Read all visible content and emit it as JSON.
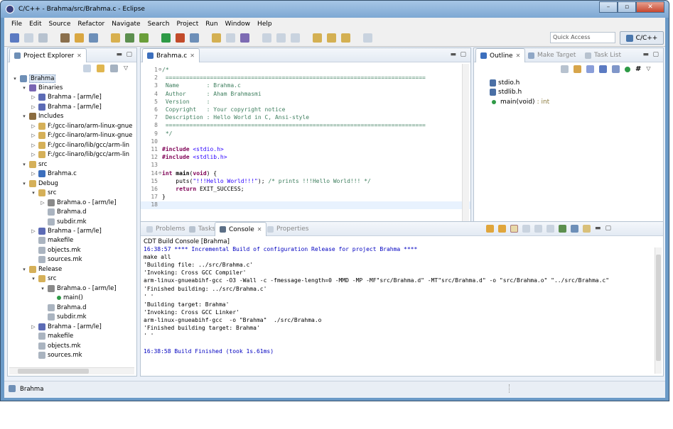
{
  "window": {
    "title": "C/C++ - Brahma/src/Brahma.c - Eclipse",
    "minimize": "–",
    "maximize": "▫",
    "close": "✕"
  },
  "menu": [
    "File",
    "Edit",
    "Source",
    "Refactor",
    "Navigate",
    "Search",
    "Project",
    "Run",
    "Window",
    "Help"
  ],
  "toolbar": {
    "quick_access_placeholder": "Quick Access",
    "perspective": "C/C++"
  },
  "colors": {
    "accent": "#4a77ad",
    "comment": "#3f7f5f",
    "keyword": "#7f0055",
    "string": "#2a00ff",
    "console_blue": "#0000c0"
  },
  "project_explorer": {
    "tab": "Project Explorer",
    "items": [
      {
        "label": "Brahma",
        "depth": 0,
        "arrow": "▾",
        "icon": "project-icon",
        "color": "#6e8fb6"
      },
      {
        "label": "Binaries",
        "depth": 1,
        "arrow": "▾",
        "icon": "binaries-icon",
        "color": "#7a66b3"
      },
      {
        "label": "Brahma - [arm/le]",
        "depth": 2,
        "arrow": "▷",
        "icon": "binary-file-icon",
        "color": "#5c6bb5"
      },
      {
        "label": "Brahma - [arm/le]",
        "depth": 2,
        "arrow": "▷",
        "icon": "binary-file-icon",
        "color": "#5c6bb5"
      },
      {
        "label": "Includes",
        "depth": 1,
        "arrow": "▾",
        "icon": "includes-icon",
        "color": "#8b6c3f"
      },
      {
        "label": "F:/gcc-linaro/arm-linux-gnue",
        "depth": 2,
        "arrow": "▷",
        "icon": "folder-icon",
        "color": "#d5b059"
      },
      {
        "label": "F:/gcc-linaro/arm-linux-gnue",
        "depth": 2,
        "arrow": "▷",
        "icon": "folder-icon",
        "color": "#d5b059"
      },
      {
        "label": "F:/gcc-linaro/lib/gcc/arm-lin",
        "depth": 2,
        "arrow": "▷",
        "icon": "folder-icon",
        "color": "#d5b059"
      },
      {
        "label": "F:/gcc-linaro/lib/gcc/arm-lin",
        "depth": 2,
        "arrow": "▷",
        "icon": "folder-icon",
        "color": "#d5b059"
      },
      {
        "label": "src",
        "depth": 1,
        "arrow": "▾",
        "icon": "source-folder-icon",
        "color": "#d5b059"
      },
      {
        "label": "Brahma.c",
        "depth": 2,
        "arrow": "▷",
        "icon": "c-file-icon",
        "color": "#3c6fbd"
      },
      {
        "label": "Debug",
        "depth": 1,
        "arrow": "▾",
        "icon": "folder-icon",
        "color": "#d5b059"
      },
      {
        "label": "src",
        "depth": 2,
        "arrow": "▾",
        "icon": "folder-icon",
        "color": "#d5b059"
      },
      {
        "label": "Brahma.o - [arm/le]",
        "depth": 3,
        "arrow": "▷",
        "icon": "object-file-icon",
        "color": "#8a8a8a"
      },
      {
        "label": "Brahma.d",
        "depth": 3,
        "arrow": "",
        "icon": "file-icon",
        "color": "#aab4c0"
      },
      {
        "label": "subdir.mk",
        "depth": 3,
        "arrow": "",
        "icon": "file-icon",
        "color": "#aab4c0"
      },
      {
        "label": "Brahma - [arm/le]",
        "depth": 2,
        "arrow": "▷",
        "icon": "binary-file-icon",
        "color": "#5c6bb5"
      },
      {
        "label": "makefile",
        "depth": 2,
        "arrow": "",
        "icon": "file-icon",
        "color": "#aab4c0"
      },
      {
        "label": "objects.mk",
        "depth": 2,
        "arrow": "",
        "icon": "file-icon",
        "color": "#aab4c0"
      },
      {
        "label": "sources.mk",
        "depth": 2,
        "arrow": "",
        "icon": "file-icon",
        "color": "#aab4c0"
      },
      {
        "label": "Release",
        "depth": 1,
        "arrow": "▾",
        "icon": "folder-icon",
        "color": "#d5b059"
      },
      {
        "label": "src",
        "depth": 2,
        "arrow": "▾",
        "icon": "folder-icon",
        "color": "#d5b059"
      },
      {
        "label": "Brahma.o - [arm/le]",
        "depth": 3,
        "arrow": "▾",
        "icon": "object-file-icon",
        "color": "#8a8a8a"
      },
      {
        "label": "main()",
        "depth": 4,
        "arrow": "",
        "icon": "function-dot-icon",
        "color": "#2e9a46"
      },
      {
        "label": "Brahma.d",
        "depth": 3,
        "arrow": "",
        "icon": "file-icon",
        "color": "#aab4c0"
      },
      {
        "label": "subdir.mk",
        "depth": 3,
        "arrow": "",
        "icon": "file-icon",
        "color": "#aab4c0"
      },
      {
        "label": "Brahma - [arm/le]",
        "depth": 2,
        "arrow": "▷",
        "icon": "binary-file-icon",
        "color": "#5c6bb5"
      },
      {
        "label": "makefile",
        "depth": 2,
        "arrow": "",
        "icon": "file-icon",
        "color": "#aab4c0"
      },
      {
        "label": "objects.mk",
        "depth": 2,
        "arrow": "",
        "icon": "file-icon",
        "color": "#aab4c0"
      },
      {
        "label": "sources.mk",
        "depth": 2,
        "arrow": "",
        "icon": "file-icon",
        "color": "#aab4c0"
      }
    ]
  },
  "editor": {
    "tab": "Brahma.c",
    "lines": [
      {
        "n": "1",
        "html": "<span class='cm'>/*</span>"
      },
      {
        "n": "2",
        "html": "<span class='cm'> ============================================================================</span>"
      },
      {
        "n": "3",
        "html": "<span class='cm'> Name        : Brahma.c</span>"
      },
      {
        "n": "4",
        "html": "<span class='cm'> Author      : Aham Brahmasmi</span>"
      },
      {
        "n": "5",
        "html": "<span class='cm'> Version     :</span>"
      },
      {
        "n": "6",
        "html": "<span class='cm'> Copyright   : Your copyright notice</span>"
      },
      {
        "n": "7",
        "html": "<span class='cm'> Description : Hello World in C, Ansi-style</span>"
      },
      {
        "n": "8",
        "html": "<span class='cm'> ============================================================================</span>"
      },
      {
        "n": "9",
        "html": "<span class='cm'> */</span>"
      },
      {
        "n": "10",
        "html": ""
      },
      {
        "n": "11",
        "html": "<span class='kw'>#include</span> <span class='st'>&lt;stdio.h&gt;</span>"
      },
      {
        "n": "12",
        "html": "<span class='kw'>#include</span> <span class='st'>&lt;stdlib.h&gt;</span>"
      },
      {
        "n": "13",
        "html": ""
      },
      {
        "n": "14",
        "html": "<span class='kw'>int</span> <b>main</b>(<span class='kw'>void</span>) {"
      },
      {
        "n": "15",
        "html": "    puts(<span class='st'>\"!!!Hello World!!!\"</span>); <span class='cm'>/* prints !!!Hello World!!! */</span>"
      },
      {
        "n": "16",
        "html": "    <span class='kw'>return</span> EXIT_SUCCESS;"
      },
      {
        "n": "17",
        "html": "}"
      },
      {
        "n": "18",
        "html": ""
      }
    ]
  },
  "outline": {
    "tabs": [
      "Outline",
      "Make Target",
      "Task List"
    ],
    "items": [
      {
        "label": "stdio.h",
        "type": "",
        "icon": "include-icon"
      },
      {
        "label": "stdlib.h",
        "type": "",
        "icon": "include-icon"
      },
      {
        "label": "main(void)",
        "type": " : int",
        "icon": "function-dot-icon"
      }
    ]
  },
  "console": {
    "tabs": [
      "Problems",
      "Tasks",
      "Console",
      "Properties"
    ],
    "header": "CDT Build Console [Brahma]",
    "lines": [
      {
        "t": "16:38:57 **** Incremental Build of configuration Release for project Brahma ****",
        "c": "blue"
      },
      {
        "t": "make all",
        "c": ""
      },
      {
        "t": "'Building file: ../src/Brahma.c'",
        "c": ""
      },
      {
        "t": "'Invoking: Cross GCC Compiler'",
        "c": ""
      },
      {
        "t": "arm-linux-gnueabihf-gcc -O3 -Wall -c -fmessage-length=0 -MMD -MP -MF\"src/Brahma.d\" -MT\"src/Brahma.d\" -o \"src/Brahma.o\" \"../src/Brahma.c\"",
        "c": ""
      },
      {
        "t": "'Finished building: ../src/Brahma.c'",
        "c": ""
      },
      {
        "t": "' '",
        "c": ""
      },
      {
        "t": "'Building target: Brahma'",
        "c": ""
      },
      {
        "t": "'Invoking: Cross GCC Linker'",
        "c": ""
      },
      {
        "t": "arm-linux-gnueabihf-gcc  -o \"Brahma\"  ./src/Brahma.o",
        "c": ""
      },
      {
        "t": "'Finished building target: Brahma'",
        "c": ""
      },
      {
        "t": "' '",
        "c": ""
      },
      {
        "t": "",
        "c": ""
      },
      {
        "t": "16:38:58 Build Finished (took 1s.61ms)",
        "c": "blue"
      }
    ]
  },
  "statusbar": {
    "text": "Brahma"
  }
}
